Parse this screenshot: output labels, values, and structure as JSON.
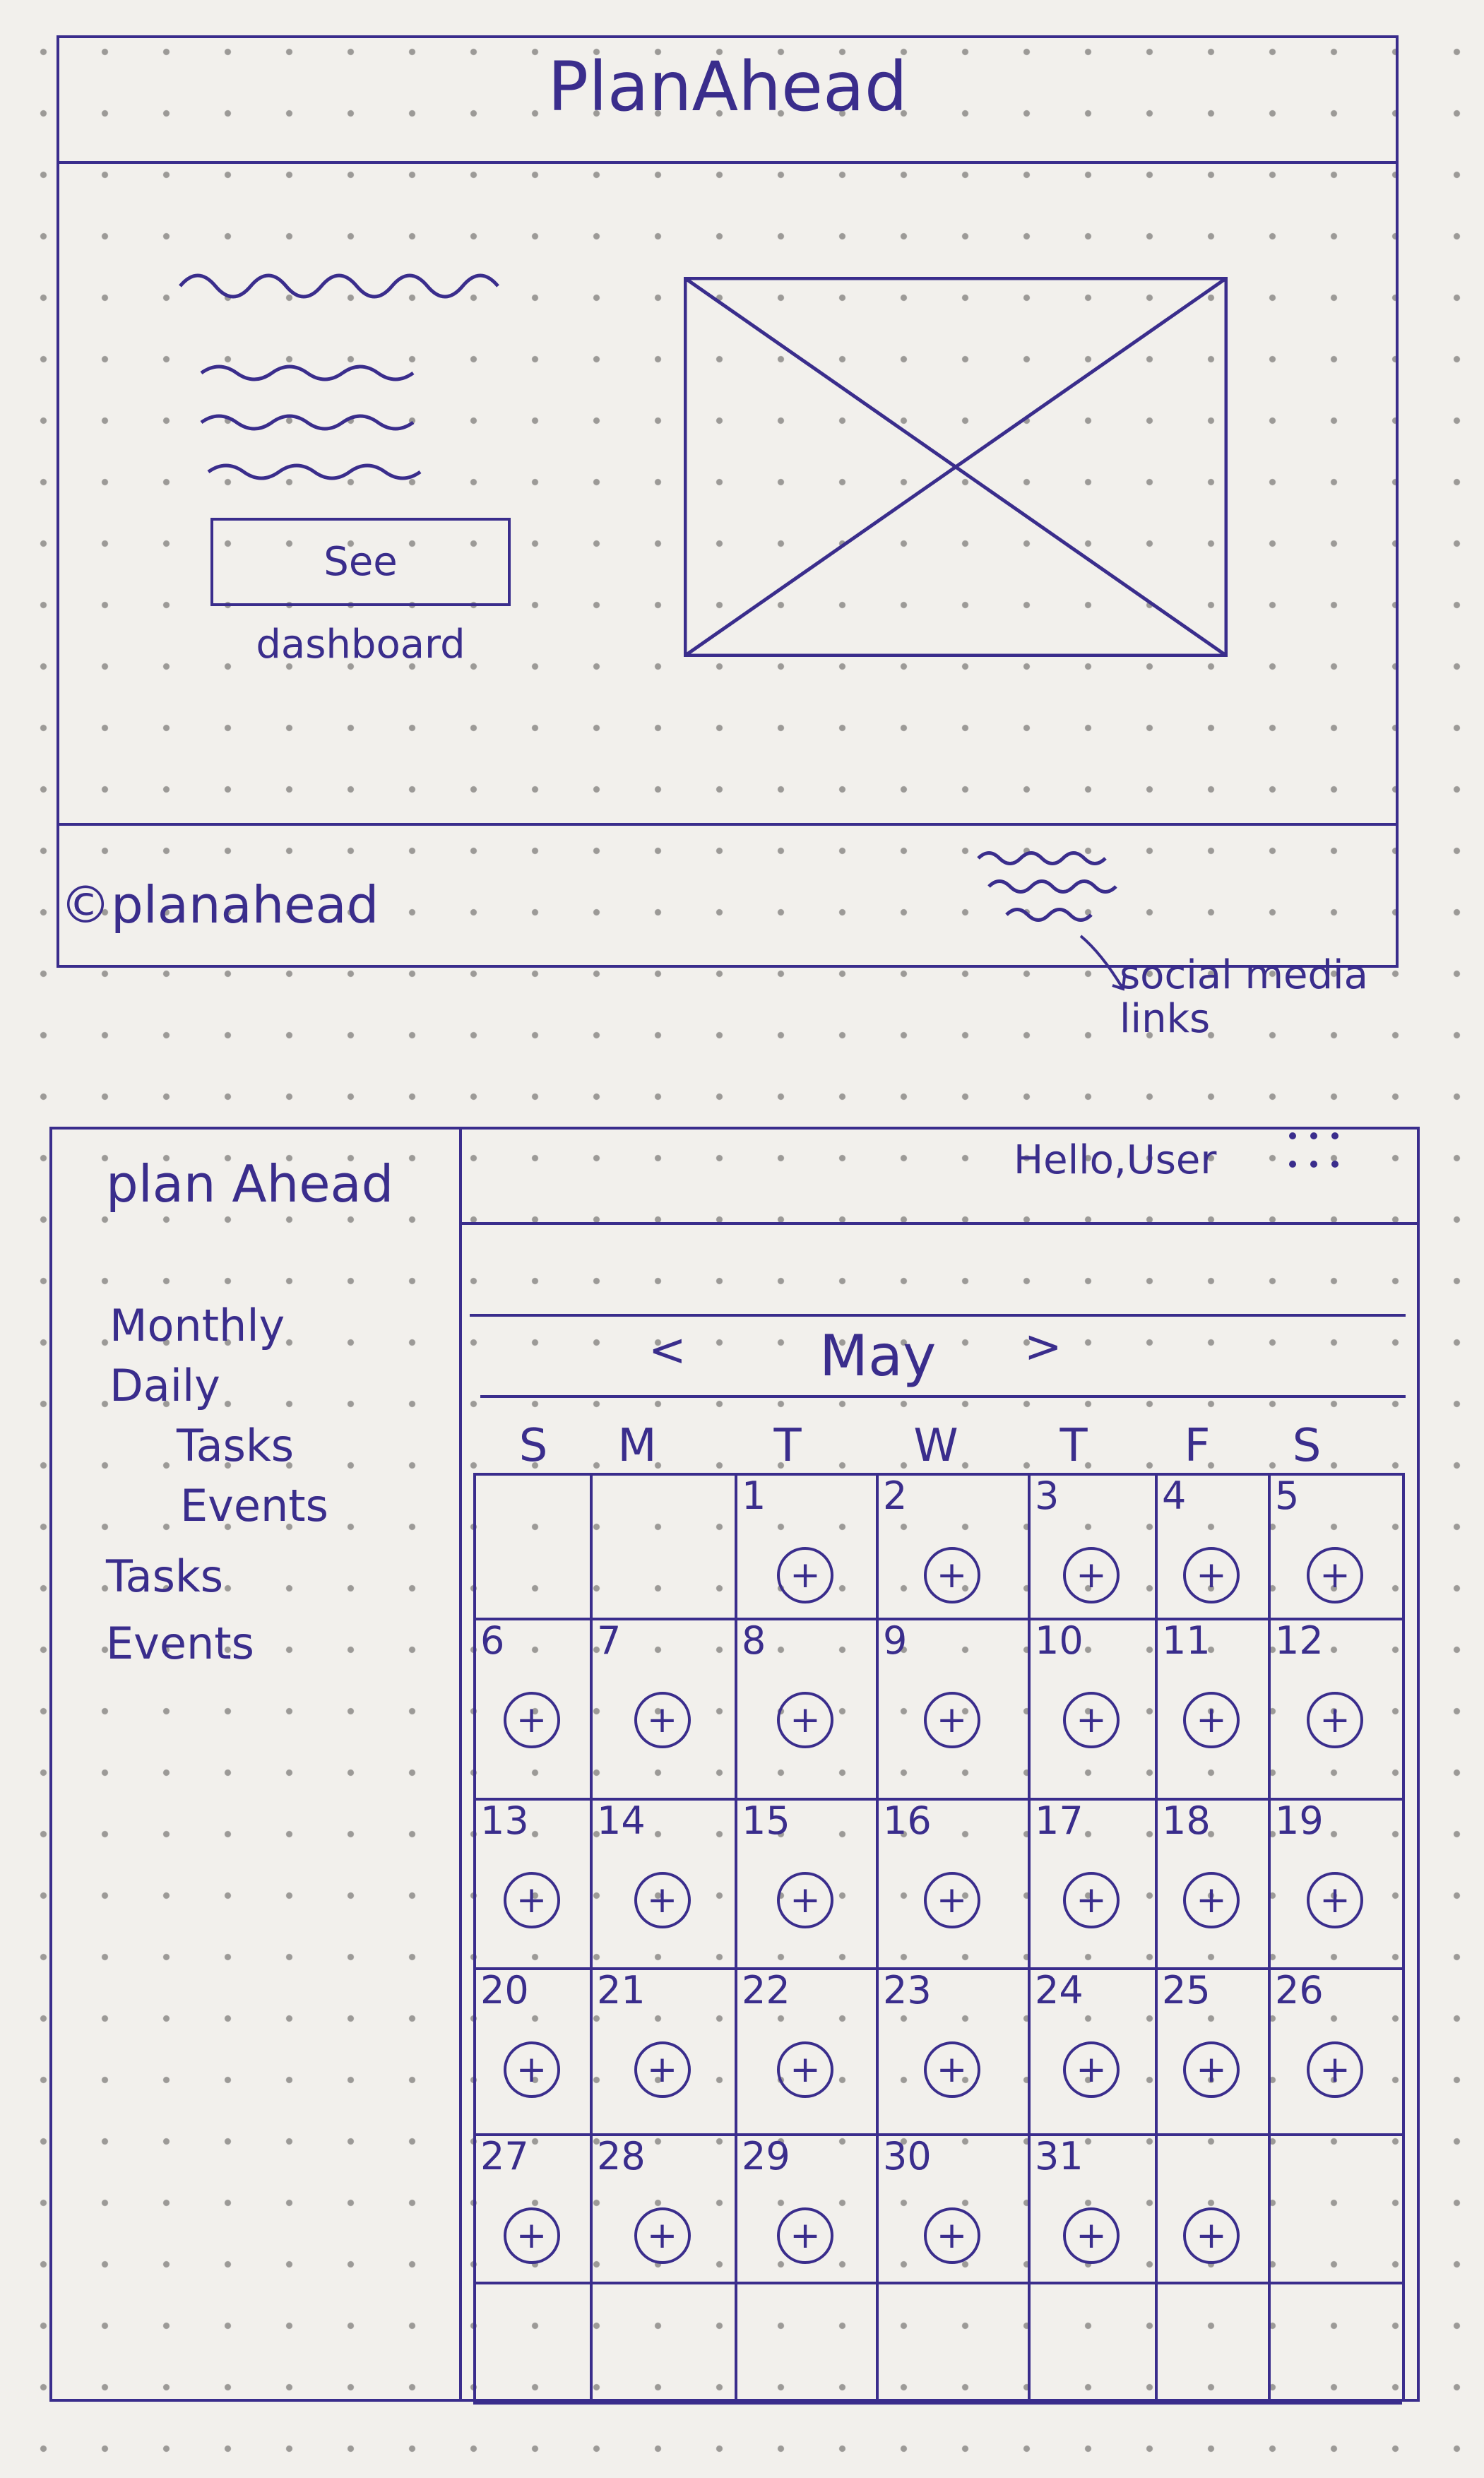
{
  "landing": {
    "title": "PlanAhead",
    "cta_label": "See dashboard",
    "footer_copyright": "©planahead",
    "annotation": "social media links"
  },
  "dashboard": {
    "brand": "plan Ahead",
    "greeting": "Hello,User",
    "sidebar": {
      "items": [
        {
          "label": "Monthly",
          "indent": 0
        },
        {
          "label": "Daily",
          "indent": 0
        },
        {
          "label": "Tasks",
          "indent": 1
        },
        {
          "label": "Events",
          "indent": 1
        },
        {
          "label": "Tasks",
          "indent": 0
        },
        {
          "label": "Events",
          "indent": 0
        }
      ]
    },
    "calendar": {
      "month": "May",
      "prev": "<",
      "next": ">",
      "weekdays": [
        "S",
        "M",
        "T",
        "W",
        "T",
        "F",
        "S"
      ],
      "add_symbol": "+",
      "weeks": [
        [
          null,
          null,
          1,
          2,
          3,
          4,
          5
        ],
        [
          6,
          7,
          8,
          9,
          10,
          11,
          12
        ],
        [
          13,
          14,
          15,
          16,
          17,
          18,
          19
        ],
        [
          20,
          21,
          22,
          23,
          24,
          25,
          26
        ],
        [
          27,
          28,
          29,
          30,
          31,
          "+",
          null
        ]
      ]
    }
  },
  "colors": {
    "ink": "#3a2d8c",
    "paper": "#f2f0ec",
    "dot": "#9c9a97"
  }
}
